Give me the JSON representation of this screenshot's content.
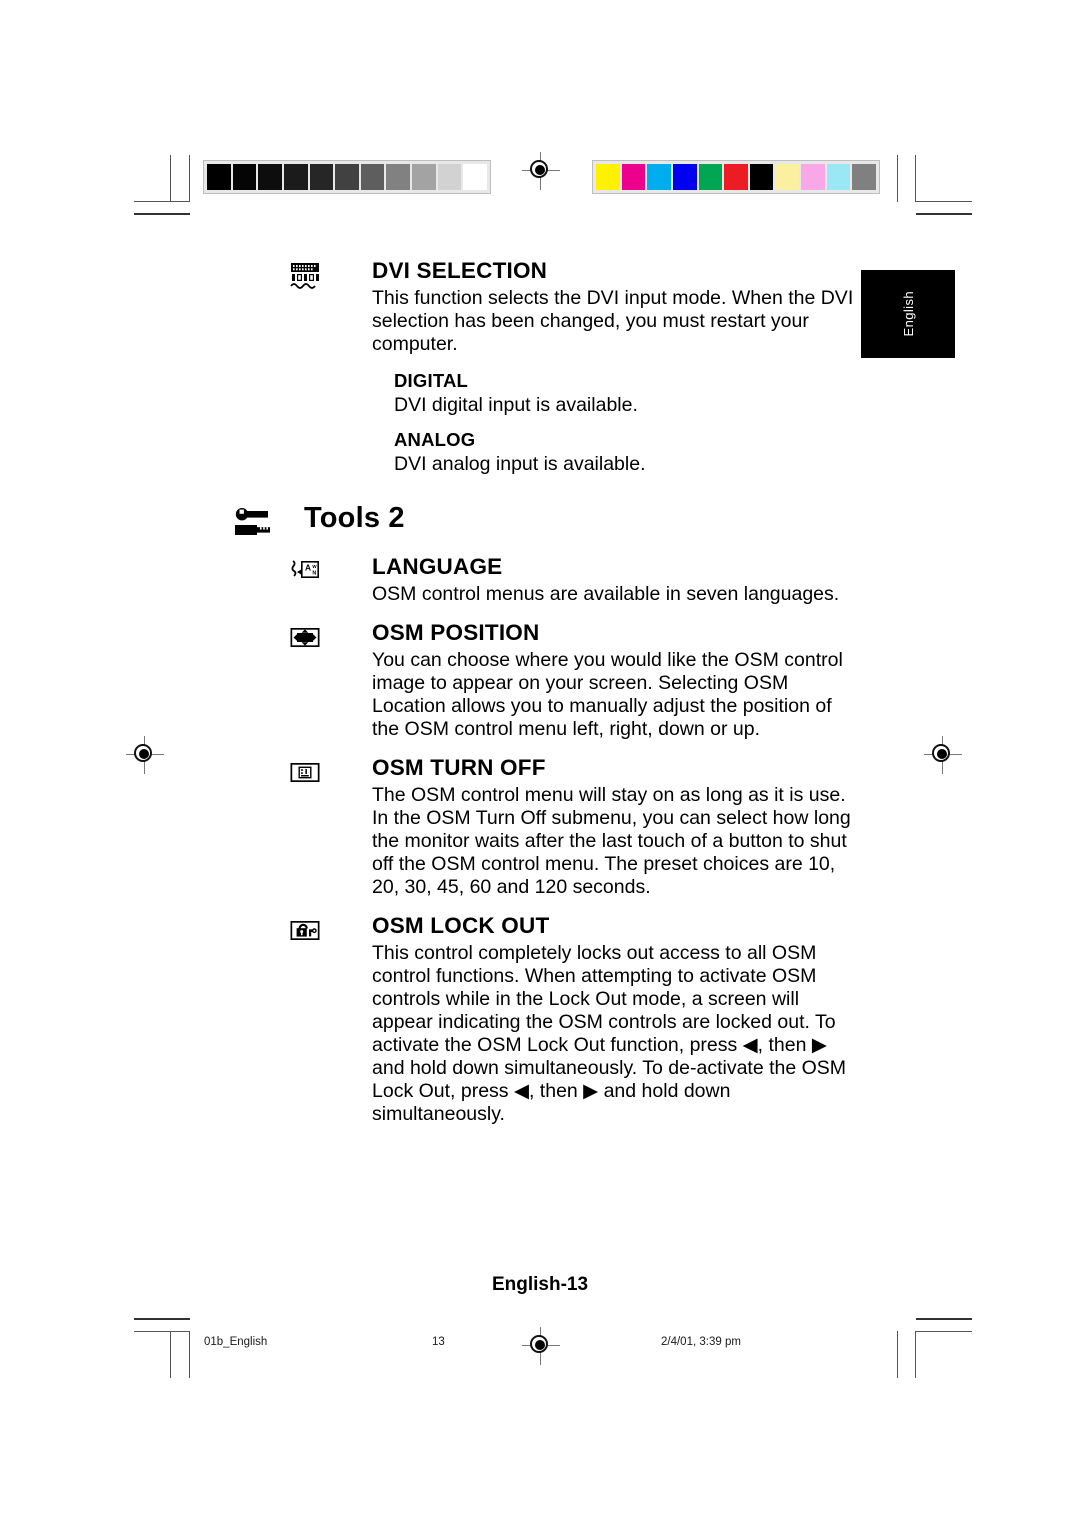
{
  "page": {
    "language_tab": "English",
    "page_label": "English-13"
  },
  "calibration": {
    "grayscale_label": "grayscale-calibration-bar",
    "grayscale_swatches": [
      "#000000",
      "#050505",
      "#0d0d0d",
      "#1b1b1b",
      "#262626",
      "#414141",
      "#5e5e5e",
      "#818181",
      "#a3a3a3",
      "#d2d2d2",
      "#ffffff"
    ],
    "color_label": "color-calibration-bar",
    "color_swatches": [
      "#fff200",
      "#ec008c",
      "#00aeef",
      "#0000f0",
      "#00a651",
      "#ed1c24",
      "#000000",
      "#fbf0a0",
      "#f9a8e7",
      "#9ae8f5",
      "#808080"
    ]
  },
  "sections": [
    {
      "icon": "dvi-connector-icon",
      "title": "DVI SELECTION",
      "text": "This function selects the DVI input mode. When the DVI selection has been changed, you must restart your computer.",
      "subsections": [
        {
          "title": "DIGITAL",
          "text": "DVI digital input is available."
        },
        {
          "title": "ANALOG",
          "text": "DVI analog input is available."
        }
      ]
    },
    {
      "icon": "language-icon",
      "title": "LANGUAGE",
      "text": "OSM control menus are available in seven languages.",
      "subsections": []
    },
    {
      "icon": "osm-position-icon",
      "title": "OSM POSITION",
      "text": "You can choose where you would like the OSM control image to appear on your screen. Selecting OSM Location allows you to manually adjust the position of the OSM control menu left, right, down or up.",
      "subsections": []
    },
    {
      "icon": "osm-turn-off-icon",
      "title": "OSM TURN OFF",
      "text": "The OSM control menu will stay on as long as it is use. In the OSM Turn Off submenu, you can select how long the monitor waits after the last touch of a button to shut off the OSM control menu. The preset choices are 10, 20, 30, 45, 60 and 120 seconds.",
      "subsections": []
    },
    {
      "icon": "osm-lock-out-icon",
      "title": "OSM LOCK OUT",
      "text": "This control completely locks out access to all OSM control functions. When attempting to activate OSM controls while in the Lock Out mode, a screen will appear indicating the OSM controls are locked out. To activate the OSM Lock Out function, press ◀, then ▶ and hold down simultaneously. To de-activate the OSM Lock Out, press ◀, then ▶ and hold down simultaneously.",
      "subsections": []
    }
  ],
  "group_heading": {
    "icon": "wrench-key-icon",
    "title": "Tools 2"
  },
  "footer": {
    "file_name": "01b_English",
    "page_number": "13",
    "timestamp": "2/4/01, 3:39 pm"
  }
}
